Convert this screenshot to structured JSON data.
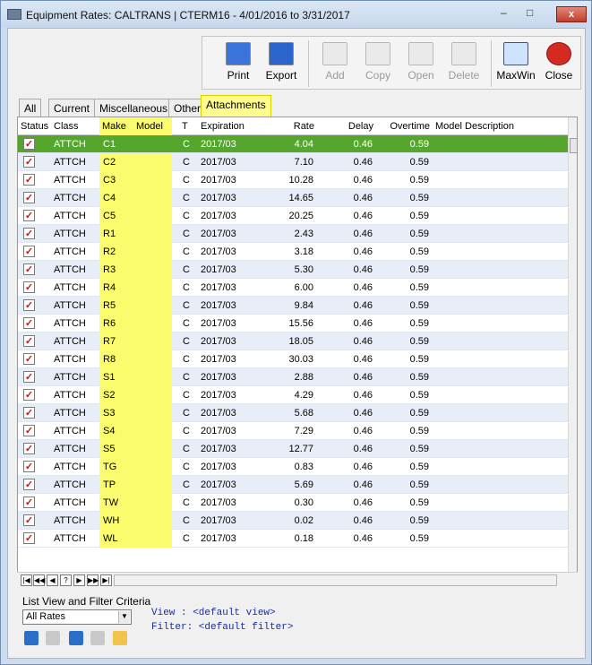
{
  "window": {
    "title": "Equipment Rates: CALTRANS | CTERM16 -  4/01/2016 to  3/31/2017",
    "min": "–",
    "max": "□",
    "close": "x"
  },
  "toolbar": {
    "print": "Print",
    "export": "Export",
    "add": "Add",
    "copy": "Copy",
    "open": "Open",
    "delete": "Delete",
    "maxwin": "MaxWin",
    "close": "Close"
  },
  "tabs": [
    "All",
    "Current",
    "Miscellaneous",
    "Other",
    "Attachments"
  ],
  "columns": [
    "Status",
    "Class",
    "Make",
    "Model",
    "T",
    "Expiration",
    "Rate",
    "Delay",
    "Overtime",
    "Model Description"
  ],
  "rows": [
    {
      "class": "ATTCH",
      "make": "C1",
      "model": "",
      "t": "C",
      "exp": "2017/03",
      "rate": "4.04",
      "delay": "0.46",
      "ot": "0.59",
      "desc": ""
    },
    {
      "class": "ATTCH",
      "make": "C2",
      "model": "",
      "t": "C",
      "exp": "2017/03",
      "rate": "7.10",
      "delay": "0.46",
      "ot": "0.59",
      "desc": ""
    },
    {
      "class": "ATTCH",
      "make": "C3",
      "model": "",
      "t": "C",
      "exp": "2017/03",
      "rate": "10.28",
      "delay": "0.46",
      "ot": "0.59",
      "desc": ""
    },
    {
      "class": "ATTCH",
      "make": "C4",
      "model": "",
      "t": "C",
      "exp": "2017/03",
      "rate": "14.65",
      "delay": "0.46",
      "ot": "0.59",
      "desc": ""
    },
    {
      "class": "ATTCH",
      "make": "C5",
      "model": "",
      "t": "C",
      "exp": "2017/03",
      "rate": "20.25",
      "delay": "0.46",
      "ot": "0.59",
      "desc": ""
    },
    {
      "class": "ATTCH",
      "make": "R1",
      "model": "",
      "t": "C",
      "exp": "2017/03",
      "rate": "2.43",
      "delay": "0.46",
      "ot": "0.59",
      "desc": ""
    },
    {
      "class": "ATTCH",
      "make": "R2",
      "model": "",
      "t": "C",
      "exp": "2017/03",
      "rate": "3.18",
      "delay": "0.46",
      "ot": "0.59",
      "desc": ""
    },
    {
      "class": "ATTCH",
      "make": "R3",
      "model": "",
      "t": "C",
      "exp": "2017/03",
      "rate": "5.30",
      "delay": "0.46",
      "ot": "0.59",
      "desc": ""
    },
    {
      "class": "ATTCH",
      "make": "R4",
      "model": "",
      "t": "C",
      "exp": "2017/03",
      "rate": "6.00",
      "delay": "0.46",
      "ot": "0.59",
      "desc": ""
    },
    {
      "class": "ATTCH",
      "make": "R5",
      "model": "",
      "t": "C",
      "exp": "2017/03",
      "rate": "9.84",
      "delay": "0.46",
      "ot": "0.59",
      "desc": ""
    },
    {
      "class": "ATTCH",
      "make": "R6",
      "model": "",
      "t": "C",
      "exp": "2017/03",
      "rate": "15.56",
      "delay": "0.46",
      "ot": "0.59",
      "desc": ""
    },
    {
      "class": "ATTCH",
      "make": "R7",
      "model": "",
      "t": "C",
      "exp": "2017/03",
      "rate": "18.05",
      "delay": "0.46",
      "ot": "0.59",
      "desc": ""
    },
    {
      "class": "ATTCH",
      "make": "R8",
      "model": "",
      "t": "C",
      "exp": "2017/03",
      "rate": "30.03",
      "delay": "0.46",
      "ot": "0.59",
      "desc": ""
    },
    {
      "class": "ATTCH",
      "make": "S1",
      "model": "",
      "t": "C",
      "exp": "2017/03",
      "rate": "2.88",
      "delay": "0.46",
      "ot": "0.59",
      "desc": ""
    },
    {
      "class": "ATTCH",
      "make": "S2",
      "model": "",
      "t": "C",
      "exp": "2017/03",
      "rate": "4.29",
      "delay": "0.46",
      "ot": "0.59",
      "desc": ""
    },
    {
      "class": "ATTCH",
      "make": "S3",
      "model": "",
      "t": "C",
      "exp": "2017/03",
      "rate": "5.68",
      "delay": "0.46",
      "ot": "0.59",
      "desc": ""
    },
    {
      "class": "ATTCH",
      "make": "S4",
      "model": "",
      "t": "C",
      "exp": "2017/03",
      "rate": "7.29",
      "delay": "0.46",
      "ot": "0.59",
      "desc": ""
    },
    {
      "class": "ATTCH",
      "make": "S5",
      "model": "",
      "t": "C",
      "exp": "2017/03",
      "rate": "12.77",
      "delay": "0.46",
      "ot": "0.59",
      "desc": ""
    },
    {
      "class": "ATTCH",
      "make": "TG",
      "model": "",
      "t": "C",
      "exp": "2017/03",
      "rate": "0.83",
      "delay": "0.46",
      "ot": "0.59",
      "desc": ""
    },
    {
      "class": "ATTCH",
      "make": "TP",
      "model": "",
      "t": "C",
      "exp": "2017/03",
      "rate": "5.69",
      "delay": "0.46",
      "ot": "0.59",
      "desc": ""
    },
    {
      "class": "ATTCH",
      "make": "TW",
      "model": "",
      "t": "C",
      "exp": "2017/03",
      "rate": "0.30",
      "delay": "0.46",
      "ot": "0.59",
      "desc": ""
    },
    {
      "class": "ATTCH",
      "make": "WH",
      "model": "",
      "t": "C",
      "exp": "2017/03",
      "rate": "0.02",
      "delay": "0.46",
      "ot": "0.59",
      "desc": ""
    },
    {
      "class": "ATTCH",
      "make": "WL",
      "model": "",
      "t": "C",
      "exp": "2017/03",
      "rate": "0.18",
      "delay": "0.46",
      "ot": "0.59",
      "desc": ""
    }
  ],
  "filter": {
    "title": "List View and Filter Criteria",
    "selected": "All Rates",
    "view": "View   : <default view>",
    "filter": "Filter: <default filter>"
  },
  "colors": {
    "selected_row": "#54a62c",
    "highlight": "#fbfc6d",
    "accent": "#182c9f"
  }
}
